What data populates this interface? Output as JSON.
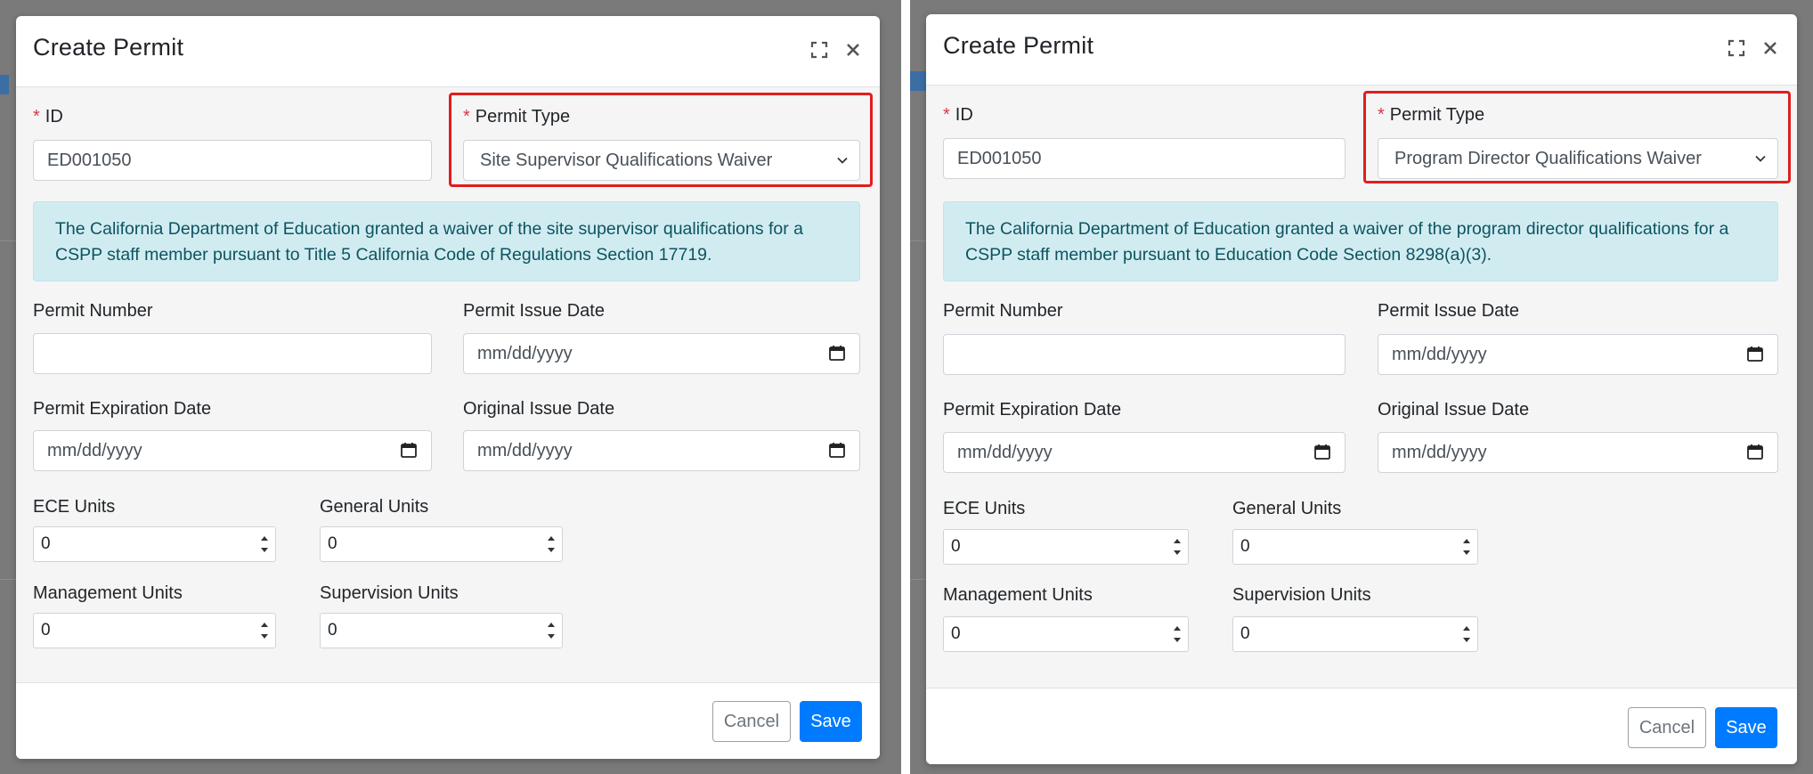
{
  "panels": [
    {
      "title": "Create Permit",
      "id_label": "ID",
      "id_value": "ED001050",
      "permit_type_label": "Permit Type",
      "permit_type_value": "Site Supervisor Qualifications Waiver",
      "alert_text": "The California Department of Education granted a waiver of the site supervisor qualifications for a CSPP staff member pursuant to Title 5 California Code of Regulations Section 17719.",
      "permit_number_label": "Permit Number",
      "permit_number_value": "",
      "permit_issue_date_label": "Permit Issue Date",
      "permit_issue_date_placeholder": "mm/dd/yyyy",
      "permit_expiration_date_label": "Permit Expiration Date",
      "permit_expiration_date_placeholder": "mm/dd/yyyy",
      "original_issue_date_label": "Original Issue Date",
      "original_issue_date_placeholder": "mm/dd/yyyy",
      "ece_units_label": "ECE Units",
      "ece_units_value": "0",
      "general_units_label": "General Units",
      "general_units_value": "0",
      "management_units_label": "Management Units",
      "management_units_value": "0",
      "supervision_units_label": "Supervision Units",
      "supervision_units_value": "0",
      "cancel_label": "Cancel",
      "save_label": "Save"
    },
    {
      "title": "Create Permit",
      "id_label": "ID",
      "id_value": "ED001050",
      "permit_type_label": "Permit Type",
      "permit_type_value": "Program Director Qualifications Waiver",
      "alert_text": "The California Department of Education granted a waiver of the program director qualifications for a CSPP staff member pursuant to Education Code Section 8298(a)(3).",
      "permit_number_label": "Permit Number",
      "permit_number_value": "",
      "permit_issue_date_label": "Permit Issue Date",
      "permit_issue_date_placeholder": "mm/dd/yyyy",
      "permit_expiration_date_label": "Permit Expiration Date",
      "permit_expiration_date_placeholder": "mm/dd/yyyy",
      "original_issue_date_label": "Original Issue Date",
      "original_issue_date_placeholder": "mm/dd/yyyy",
      "ece_units_label": "ECE Units",
      "ece_units_value": "0",
      "general_units_label": "General Units",
      "general_units_value": "0",
      "management_units_label": "Management Units",
      "management_units_value": "0",
      "supervision_units_label": "Supervision Units",
      "supervision_units_value": "0",
      "cancel_label": "Cancel",
      "save_label": "Save"
    }
  ],
  "colors": {
    "highlight": "#e01e1e",
    "primary": "#007bff",
    "alert_bg": "#d1ecf1",
    "alert_text": "#0c5460",
    "required": "#dc3545"
  },
  "icons": [
    "expand-icon",
    "close-icon",
    "calendar-icon",
    "chevron-down-icon",
    "spinner-arrows-icon"
  ]
}
